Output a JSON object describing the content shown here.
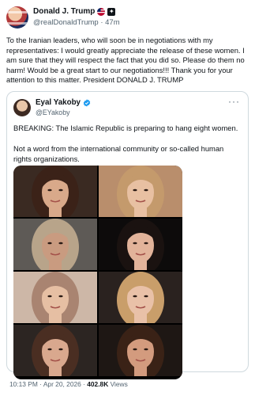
{
  "post": {
    "author_name": "Donald J. Trump",
    "author_handle": "@realDonaldTrump",
    "time_ago": "47m",
    "separator": "·",
    "text": "To the Iranian leaders, who will soon be in negotiations with my representatives: I would greatly appreciate the release of these women. I am sure that they will respect the fact that you did so. Please do them no harm! Would be a great start to our negotiations!!! Thank you for your attention to this matter. President DONALD J. TRUMP"
  },
  "quote": {
    "author_name": "Eyal Yakoby",
    "author_handle": "@EYakoby",
    "more": "···",
    "text_line1": "BREAKING: The Islamic Republic is preparing to hang eight women.",
    "text_line2": "Not a word from the international community or so-called human rights organizations.",
    "timestamp": "10:13 PM · Apr 20, 2026 · ",
    "views_count": "402.8K",
    "views_label": " Views"
  },
  "photos": [
    {
      "name": "photo-1",
      "bg": "#3a2a22",
      "skin": "#d9a98a",
      "hair": "#3b2218"
    },
    {
      "name": "photo-2",
      "bg": "#b98e6c",
      "skin": "#e8c0a2",
      "hair": "#c49a6c"
    },
    {
      "name": "photo-3",
      "bg": "#5e5a56",
      "skin": "#c99b80",
      "hair": "#b8a48a"
    },
    {
      "name": "photo-4",
      "bg": "#0d0b0b",
      "skin": "#e2b39a",
      "hair": "#1a1210"
    },
    {
      "name": "photo-5",
      "bg": "#cdb7a7",
      "skin": "#e6bfa3",
      "hair": "#a98471"
    },
    {
      "name": "photo-6",
      "bg": "#2a221f",
      "skin": "#e9c1a8",
      "hair": "#c99e6a"
    },
    {
      "name": "photo-7",
      "bg": "#2c2522",
      "skin": "#d9a88e",
      "hair": "#4a2e22"
    },
    {
      "name": "photo-8",
      "bg": "#1e1714",
      "skin": "#d39b7e",
      "hair": "#3a2216"
    }
  ],
  "colors": {
    "text": "#0f1419",
    "muted": "#536471",
    "verified": "#1d9bf0",
    "border": "#cfd9de"
  }
}
